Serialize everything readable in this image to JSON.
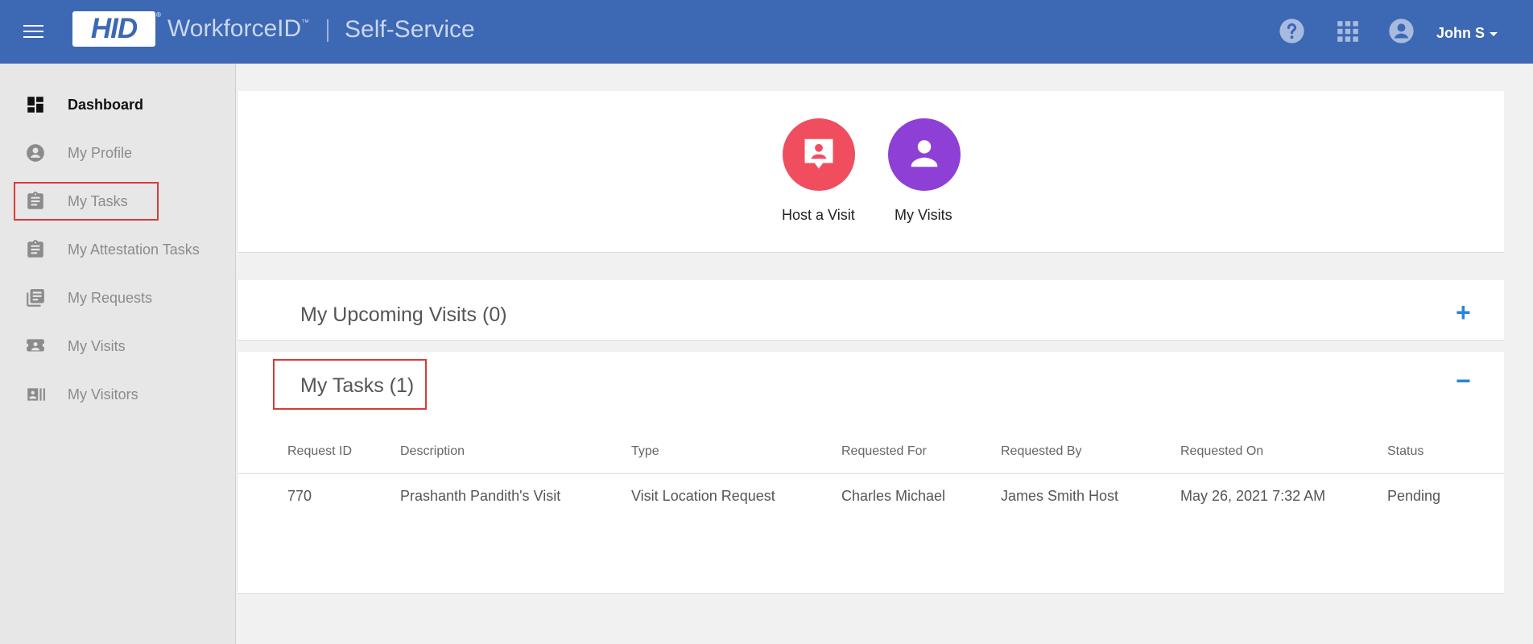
{
  "header": {
    "brand": "HID",
    "product": "WorkforceID",
    "trademark": "™",
    "portal": "Self-Service",
    "user_name": "John S"
  },
  "sidebar": {
    "items": [
      {
        "label": "Dashboard",
        "icon": "dashboard-icon",
        "active": true
      },
      {
        "label": "My Profile",
        "icon": "account-circle-icon"
      },
      {
        "label": "My Tasks",
        "icon": "clipboard-icon"
      },
      {
        "label": "My Attestation Tasks",
        "icon": "clipboard-icon"
      },
      {
        "label": "My Requests",
        "icon": "library-books-icon"
      },
      {
        "label": "My Visits",
        "icon": "badge-icon"
      },
      {
        "label": "My Visitors",
        "icon": "contacts-icon"
      }
    ]
  },
  "quick_actions": [
    {
      "label": "Host a Visit",
      "color": "#f04d5f",
      "icon": "host-visit-icon"
    },
    {
      "label": "My Visits",
      "color": "#8e3fd6",
      "icon": "person-icon"
    }
  ],
  "upcoming": {
    "title": "My Upcoming Visits (0)",
    "toggle": "+"
  },
  "tasks": {
    "title": "My Tasks (1)",
    "toggle": "−",
    "columns": [
      "Request ID",
      "Description",
      "Type",
      "Requested For",
      "Requested By",
      "Requested On",
      "Status"
    ],
    "rows": [
      [
        "770",
        "Prashanth Pandith's Visit",
        "Visit Location Request",
        "Charles Michael",
        "James Smith Host",
        "May 26, 2021 7:32 AM",
        "Pending"
      ]
    ]
  },
  "colors": {
    "header": "#3d68b4",
    "accent": "#2a84d8",
    "highlight": "#d93a3a"
  }
}
